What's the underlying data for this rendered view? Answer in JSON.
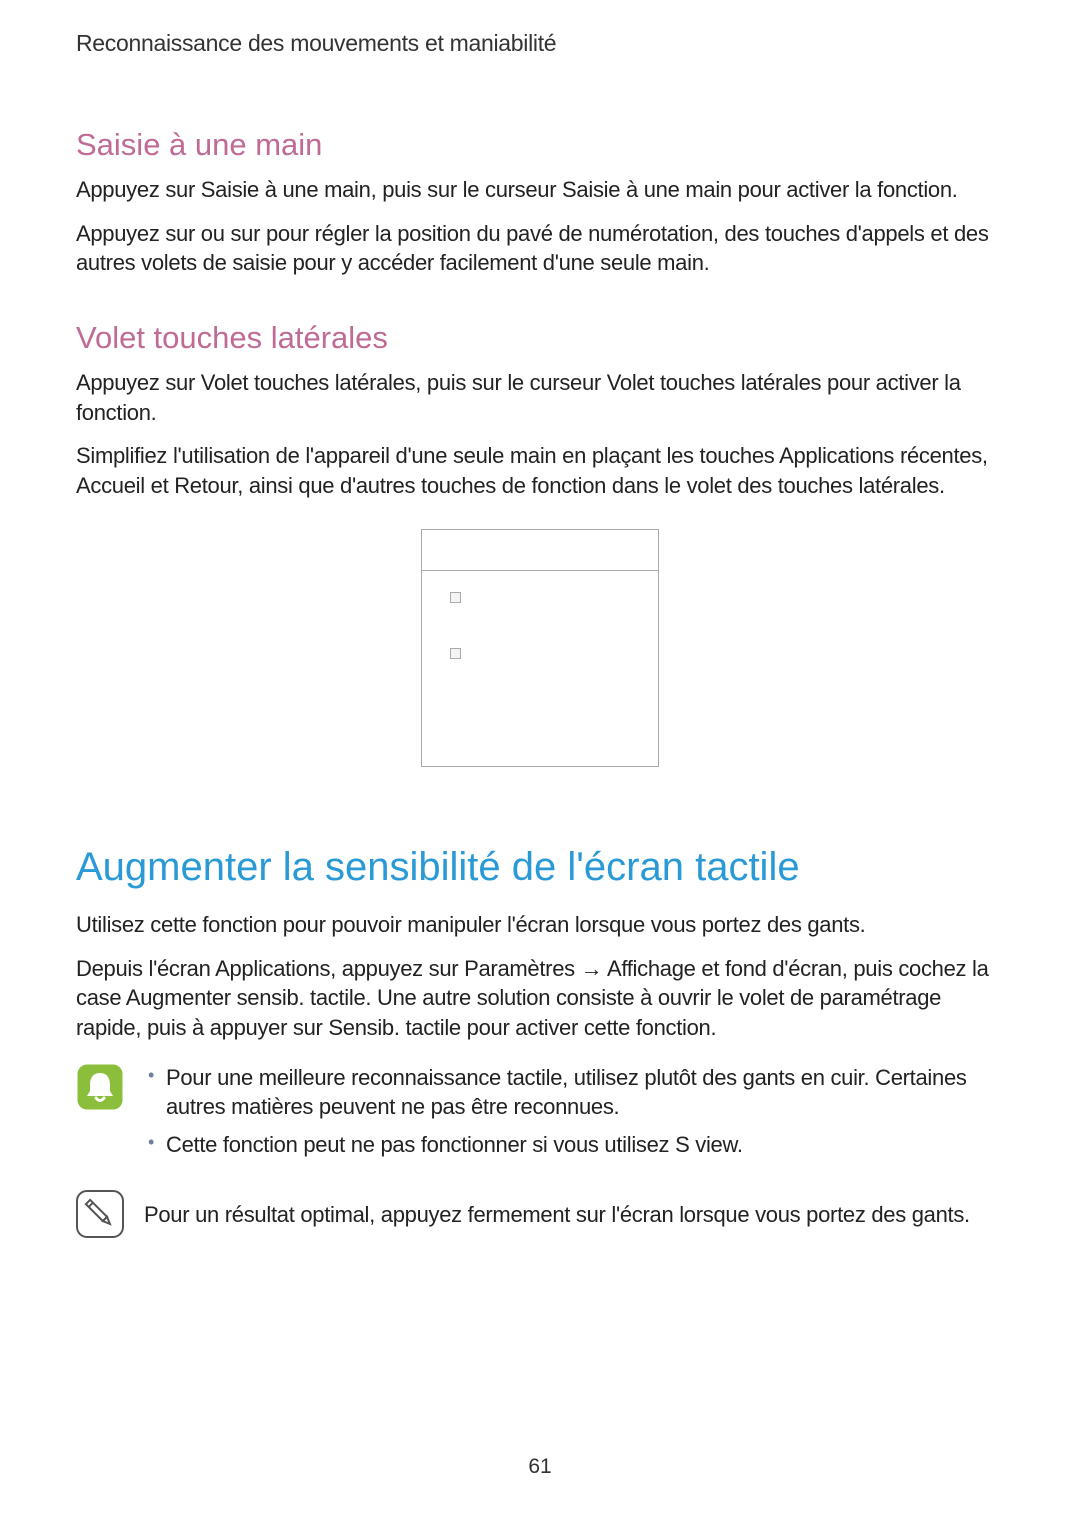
{
  "breadcrumb": "Reconnaissance des mouvements et maniabilité",
  "section_a": {
    "title": "Saisie à une main",
    "p1": "Appuyez sur Saisie à une main, puis sur le curseur Saisie à une main pour activer la fonction.",
    "p2": "Appuyez sur   ou sur   pour régler la position du pavé de numérotation, des touches d'appels et des autres volets de saisie pour y accéder facilement d'une seule main."
  },
  "section_b": {
    "title": "Volet touches latérales",
    "p1": "Appuyez sur Volet touches latérales, puis sur le curseur Volet touches latérales pour activer la fonction.",
    "p2": "Simplifiez l'utilisation de l'appareil d'une seule main en plaçant les touches Applications récentes, Accueil et Retour, ainsi que d'autres touches de fonction dans le volet des touches latérales."
  },
  "section_c": {
    "title": "Augmenter la sensibilité de l'écran tactile",
    "p1": "Utilisez cette fonction pour pouvoir manipuler l'écran lorsque vous portez des gants.",
    "p2": "Depuis l'écran Applications, appuyez sur Paramètres → Affichage et fond d'écran, puis cochez la case Augmenter sensib. tactile. Une autre solution consiste à ouvrir le volet de paramétrage rapide, puis à appuyer sur Sensib. tactile pour activer cette fonction."
  },
  "note_a": {
    "li1": "Pour une meilleure reconnaissance tactile, utilisez plutôt des gants en cuir. Certaines autres matières peuvent ne pas être reconnues.",
    "li2": "Cette fonction peut ne pas fonctionner si vous utilisez S view."
  },
  "note_b": {
    "text": "Pour un résultat optimal, appuyez fermement sur l'écran lorsque vous portez des gants."
  },
  "page_number": "61"
}
